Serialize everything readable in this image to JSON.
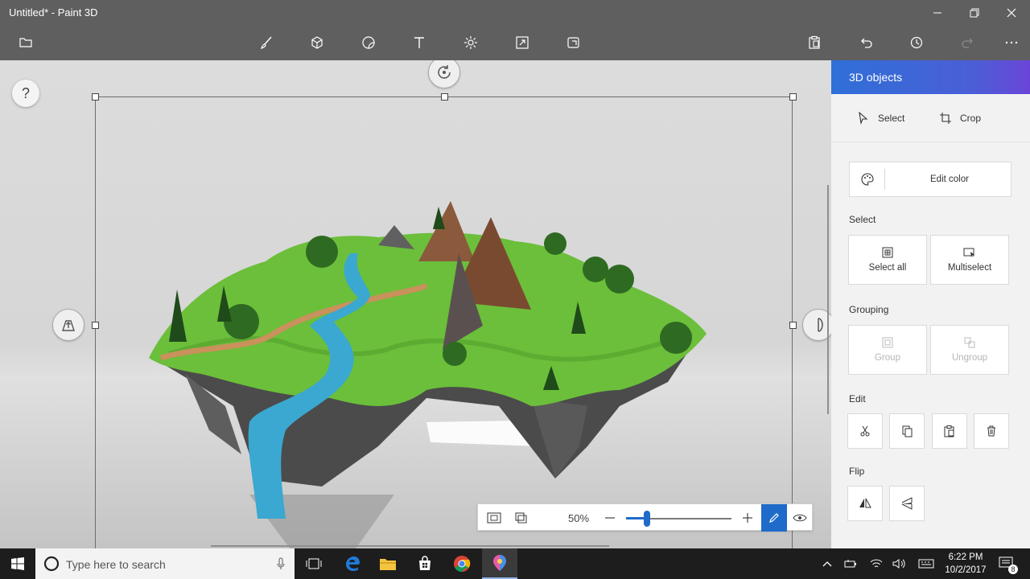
{
  "window": {
    "title": "Untitled* - Paint 3D",
    "controls": [
      "minimize-icon",
      "maximize-icon",
      "close-icon"
    ]
  },
  "toolbar": {
    "items": [
      "menu-icon",
      "brushes-icon",
      "3d-shapes-icon",
      "stickers-icon",
      "text-icon",
      "effects-icon",
      "canvas-icon",
      "remix3d-icon"
    ],
    "right_items": [
      "paste-icon",
      "undo-icon",
      "history-icon",
      "redo-icon",
      "more-icon"
    ]
  },
  "canvas": {
    "help_label": "?"
  },
  "zoom_bar": {
    "zoom_value": "50%",
    "zoom_level": 0.2
  },
  "panel": {
    "title": "3D objects",
    "select_label": "Select",
    "crop_label": "Crop",
    "edit_color_label": "Edit color",
    "select_section": "Select",
    "select_all_label": "Select all",
    "multiselect_label": "Multiselect",
    "grouping_section": "Grouping",
    "group_label": "Group",
    "ungroup_label": "Ungroup",
    "edit_section": "Edit",
    "flip_section": "Flip"
  },
  "taskbar": {
    "search_placeholder": "Type here to search",
    "time": "6:22 PM",
    "date": "10/2/2017",
    "notification_count": "8"
  },
  "colors": {
    "accent": "#1f6bc9",
    "panel_header_start": "#2f6fd8",
    "panel_header_end": "#6a46d8"
  }
}
